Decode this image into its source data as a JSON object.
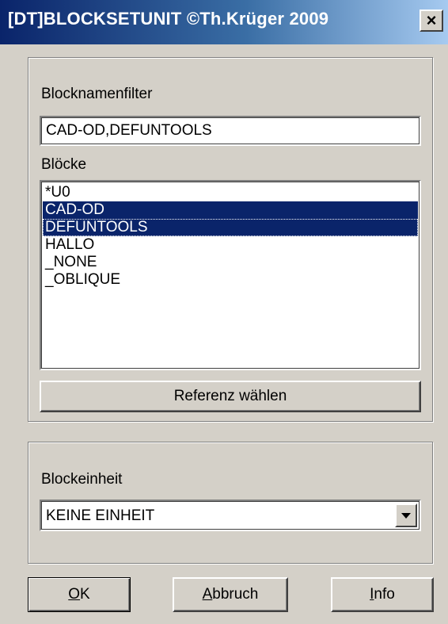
{
  "window": {
    "title": "[DT]BLOCKSETUNIT ©Th.Krüger 2009",
    "close_label": "×"
  },
  "filter": {
    "label": "Blocknamenfilter",
    "value": "CAD-OD,DEFUNTOOLS"
  },
  "blocks": {
    "label": "Blöcke",
    "items": [
      {
        "text": "*U0",
        "selected": false
      },
      {
        "text": "CAD-OD",
        "selected": true
      },
      {
        "text": "DEFUNTOOLS",
        "selected": true
      },
      {
        "text": "HALLO",
        "selected": false
      },
      {
        "text": "_NONE",
        "selected": false
      },
      {
        "text": "_OBLIQUE",
        "selected": false
      }
    ]
  },
  "reference_button": "Referenz wählen",
  "unit": {
    "label": "Blockeinheit",
    "selected": "KEINE EINHEIT"
  },
  "buttons": {
    "ok_mnemonic": "O",
    "ok_rest": "K",
    "cancel_mnemonic": "A",
    "cancel_rest": "bbruch",
    "info_mnemonic": "I",
    "info_rest": "nfo"
  },
  "colors": {
    "selection": "#0a246a",
    "face": "#d4d0c8"
  }
}
